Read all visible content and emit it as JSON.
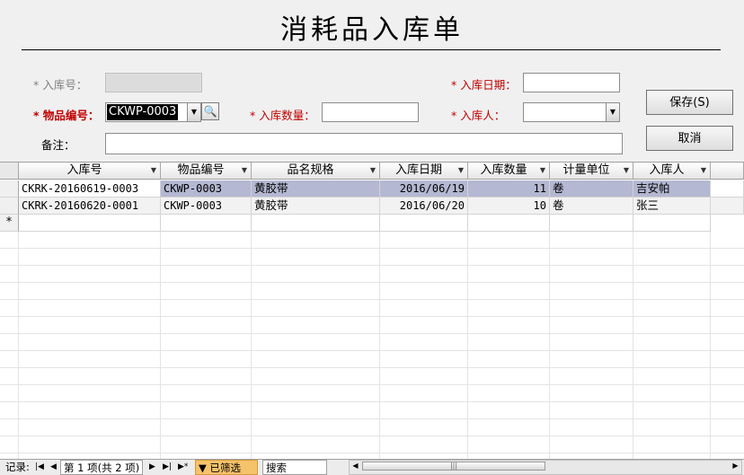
{
  "form": {
    "title": "消耗品入库单",
    "labels": {
      "inbound_no": "* 入库号：",
      "inbound_date": "* 入库日期：",
      "item_code": "* 物品编号：",
      "inbound_qty": "* 入库数量：",
      "inbound_person": "* 入库人：",
      "remark": "备注："
    },
    "values": {
      "item_code": "CKWP-0003"
    },
    "buttons": {
      "save": "保存(S)",
      "cancel": "取消"
    }
  },
  "grid": {
    "columns": [
      "入库号",
      "物品编号",
      "品名规格",
      "入库日期",
      "入库数量",
      "计量单位",
      "入库人"
    ],
    "rows": [
      [
        "CKRK-20160619-0003",
        "CKWP-0003",
        "黄胶带",
        "2016/06/19",
        "11",
        "卷",
        "吉安帕"
      ],
      [
        "CKRK-20160620-0001",
        "CKWP-0003",
        "黄胶带",
        "2016/06/20",
        "10",
        "卷",
        "张三"
      ]
    ],
    "new_row_marker": "*"
  },
  "navigator": {
    "record_label": "记录:",
    "position": "第 1 项(共 2 项)",
    "filter": "已筛选",
    "search": "搜索"
  },
  "icons": [
    "dropdown-arrow-icon",
    "lookup-magnifier-icon",
    "filter-icon",
    "nav-first-icon",
    "nav-prev-icon",
    "nav-next-icon",
    "nav-last-icon",
    "nav-new-icon"
  ]
}
